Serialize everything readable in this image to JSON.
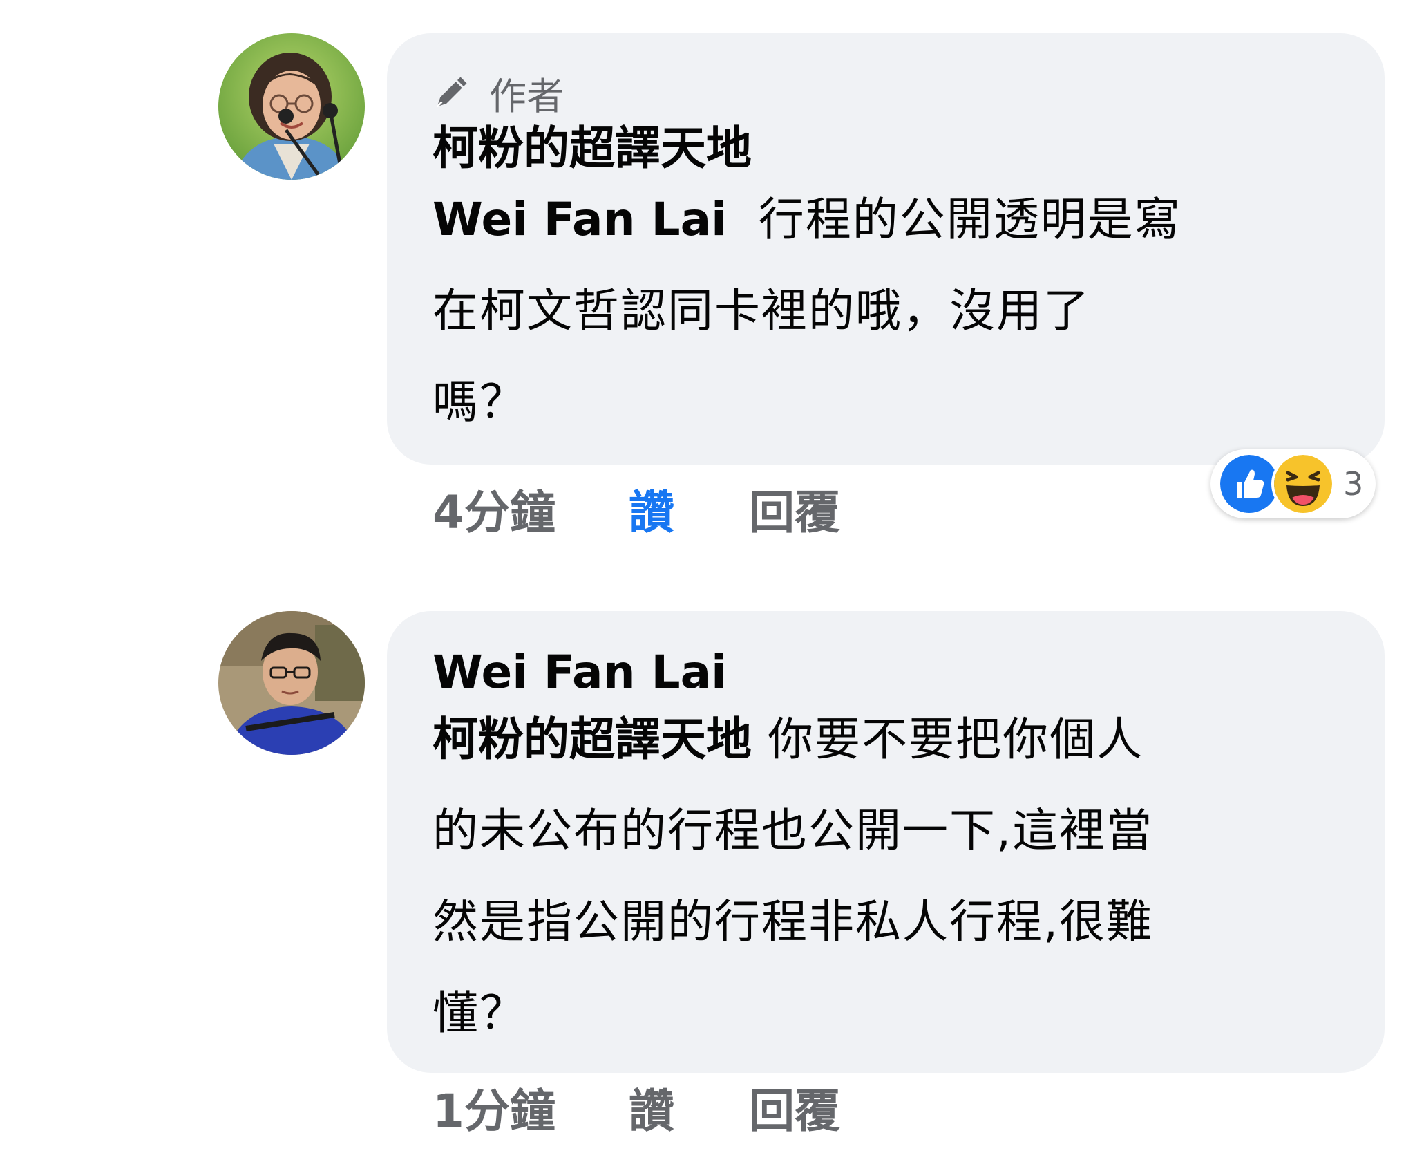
{
  "comments": [
    {
      "author_badge": "作者",
      "author_name": "柯粉的超譯天地",
      "mention": "Wei Fan Lai",
      "text_lines": [
        "行程的公開透明是寫",
        "在柯文哲認同卡裡的哦，沒用了",
        "嗎？"
      ],
      "time": "4分鐘",
      "like_label": "讚",
      "reply_label": "回覆",
      "liked": true,
      "reactions": {
        "icons": [
          "like-icon",
          "haha-icon"
        ],
        "count": "3"
      }
    },
    {
      "author_name": "Wei Fan Lai",
      "mention": "柯粉的超譯天地",
      "text_lines": [
        "你要不要把你個人",
        "的未公布的行程也公開一下,這裡當",
        "然是指公開的行程非私人行程,很難",
        "懂？"
      ],
      "time": "1分鐘",
      "like_label": "讚",
      "reply_label": "回覆",
      "liked": false
    }
  ],
  "colors": {
    "bubble": "#f0f2f5",
    "like_active": "#1877f2",
    "meta": "#65676b",
    "text": "#050505"
  }
}
